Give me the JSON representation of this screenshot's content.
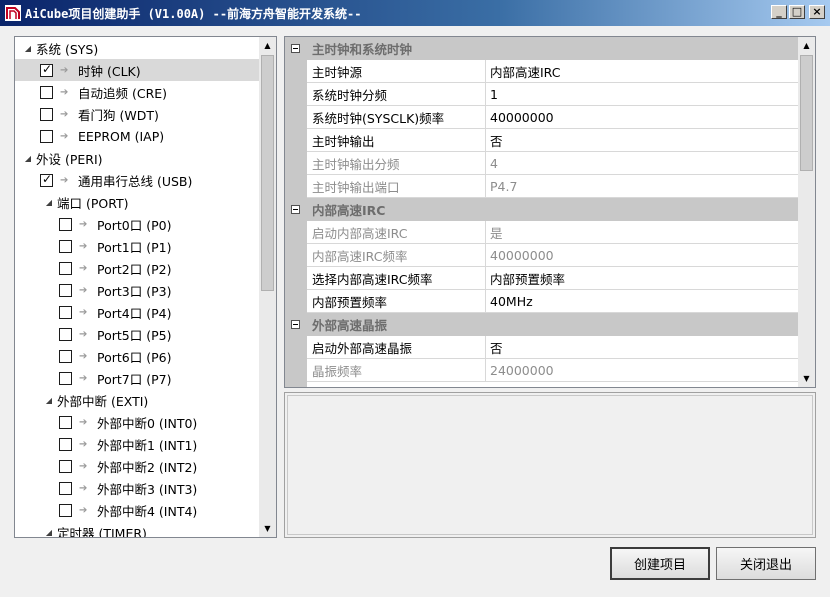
{
  "window": {
    "title": "AiCube项目创建助手 (V1.00A) --前海方舟智能开发系统--",
    "buttons": {
      "minimize": "_",
      "maximize": "□",
      "close": "×"
    }
  },
  "tree": {
    "items": [
      {
        "label": "系统 (SYS)",
        "level": 0,
        "type": "group",
        "expanded": true
      },
      {
        "label": "时钟 (CLK)",
        "level": 1,
        "type": "item",
        "checked": true,
        "selected": true
      },
      {
        "label": "自动追频 (CRE)",
        "level": 1,
        "type": "item",
        "checked": false
      },
      {
        "label": "看门狗 (WDT)",
        "level": 1,
        "type": "item",
        "checked": false
      },
      {
        "label": "EEPROM (IAP)",
        "level": 1,
        "type": "item",
        "checked": false
      },
      {
        "label": "外设 (PERI)",
        "level": 0,
        "type": "group",
        "expanded": true
      },
      {
        "label": "通用串行总线 (USB)",
        "level": 1,
        "type": "item",
        "checked": true
      },
      {
        "label": "端口 (PORT)",
        "level": 1,
        "type": "group",
        "expanded": true
      },
      {
        "label": "Port0口 (P0)",
        "level": 2,
        "type": "item",
        "checked": false
      },
      {
        "label": "Port1口 (P1)",
        "level": 2,
        "type": "item",
        "checked": false
      },
      {
        "label": "Port2口 (P2)",
        "level": 2,
        "type": "item",
        "checked": false
      },
      {
        "label": "Port3口 (P3)",
        "level": 2,
        "type": "item",
        "checked": false
      },
      {
        "label": "Port4口 (P4)",
        "level": 2,
        "type": "item",
        "checked": false
      },
      {
        "label": "Port5口 (P5)",
        "level": 2,
        "type": "item",
        "checked": false
      },
      {
        "label": "Port6口 (P6)",
        "level": 2,
        "type": "item",
        "checked": false
      },
      {
        "label": "Port7口 (P7)",
        "level": 2,
        "type": "item",
        "checked": false
      },
      {
        "label": "外部中断 (EXTI)",
        "level": 1,
        "type": "group",
        "expanded": true
      },
      {
        "label": "外部中断0 (INT0)",
        "level": 2,
        "type": "item",
        "checked": false
      },
      {
        "label": "外部中断1 (INT1)",
        "level": 2,
        "type": "item",
        "checked": false
      },
      {
        "label": "外部中断2 (INT2)",
        "level": 2,
        "type": "item",
        "checked": false
      },
      {
        "label": "外部中断3 (INT3)",
        "level": 2,
        "type": "item",
        "checked": false
      },
      {
        "label": "外部中断4 (INT4)",
        "level": 2,
        "type": "item",
        "checked": false
      },
      {
        "label": "定时器 (TIMER)",
        "level": 1,
        "type": "group",
        "expanded": true
      }
    ]
  },
  "properties": {
    "categories": [
      {
        "title": "主时钟和系统时钟",
        "rows": [
          {
            "name": "主时钟源",
            "value": "内部高速IRC",
            "enabled": true
          },
          {
            "name": "系统时钟分频",
            "value": "1",
            "enabled": true
          },
          {
            "name": "系统时钟(SYSCLK)频率",
            "value": "40000000",
            "enabled": true
          },
          {
            "name": "主时钟输出",
            "value": "否",
            "enabled": true
          },
          {
            "name": "主时钟输出分频",
            "value": "4",
            "enabled": false
          },
          {
            "name": "主时钟输出端口",
            "value": "P4.7",
            "enabled": false
          }
        ]
      },
      {
        "title": "内部高速IRC",
        "rows": [
          {
            "name": "启动内部高速IRC",
            "value": "是",
            "enabled": false
          },
          {
            "name": "内部高速IRC频率",
            "value": "40000000",
            "enabled": false
          },
          {
            "name": "选择内部高速IRC频率",
            "value": "内部预置频率",
            "enabled": true
          },
          {
            "name": "内部预置频率",
            "value": "40MHz",
            "enabled": true
          }
        ]
      },
      {
        "title": "外部高速晶振",
        "rows": [
          {
            "name": "启动外部高速晶振",
            "value": "否",
            "enabled": true
          },
          {
            "name": "晶振频率",
            "value": "24000000",
            "enabled": false
          }
        ]
      }
    ]
  },
  "actions": {
    "create": "创建项目",
    "close": "关闭退出"
  }
}
